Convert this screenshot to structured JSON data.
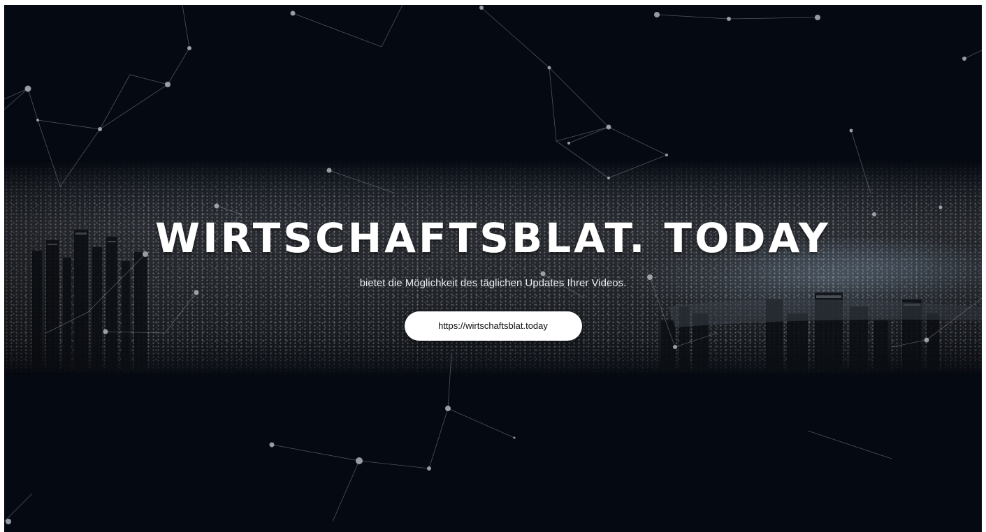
{
  "hero": {
    "title": "WIRTSCHAFTSBLAT. TODAY",
    "subtitle": "bietet die Möglichkeit des täglichen Updates Ihrer Videos.",
    "button_label": "https://wirtschaftsblat.today"
  },
  "theme": {
    "background": "#050911",
    "title_color": "#ffffff",
    "button_bg": "#ffffff",
    "button_text": "#111111"
  }
}
